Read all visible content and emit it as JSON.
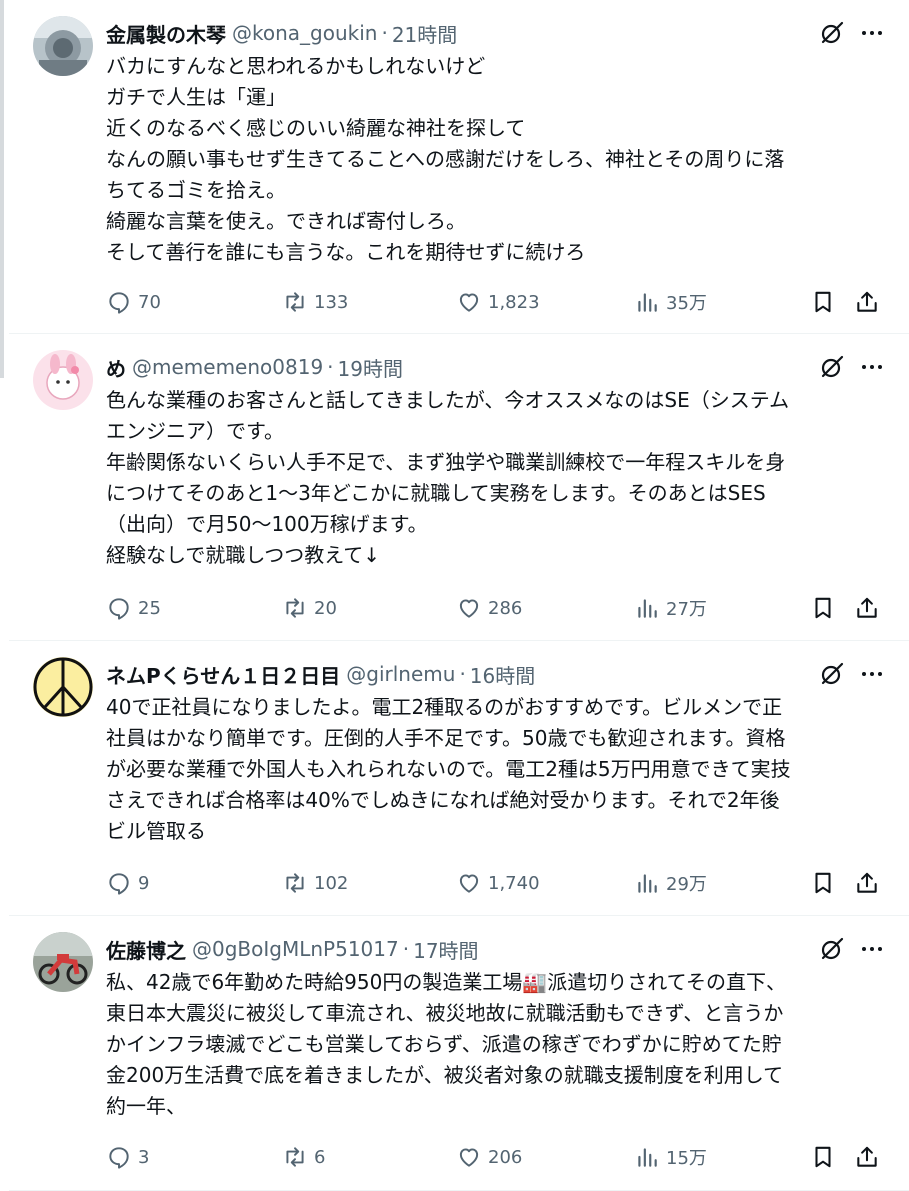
{
  "tweets": [
    {
      "name": "金属製の木琴",
      "handle": "@kona_goukin",
      "sep": "·",
      "time": "21時間",
      "lines": [
        "バカにすんなと思われるかもしれないけど",
        "ガチで人生は「運」",
        "近くのなるべく感じのいい綺麗な神社を探して",
        "なんの願い事もせず生きてることへの感謝だけをしろ、神社とその周りに落",
        "ちてるゴミを拾え。",
        "綺麗な言葉を使え。できれば寄付しろ。",
        "そして善行を誰にも言うな。これを期待せずに続けろ"
      ],
      "replies": "70",
      "retweets": "133",
      "likes": "1,823",
      "views": "35万"
    },
    {
      "name": "め",
      "handle": "@mememeno0819",
      "sep": "·",
      "time": "19時間",
      "lines": [
        "色んな業種のお客さんと話してきましたが、今オススメなのはSE（システム",
        "エンジニア）です。",
        "年齢関係ないくらい人手不足で、まず独学や職業訓練校で一年程スキルを身",
        "につけてそのあと1〜3年どこかに就職して実務をします。そのあとはSES",
        "（出向）で月50〜100万稼げます。",
        "経験なしで就職しつつ教えて↓"
      ],
      "replies": "25",
      "retweets": "20",
      "likes": "286",
      "views": "27万"
    },
    {
      "name": "ネムPくらせん１日２日目",
      "handle": "@girlnemu",
      "sep": "·",
      "time": "16時間",
      "lines": [
        "40で正社員になりましたよ。電工2種取るのがおすすめです。ビルメンで正",
        "社員はかなり簡単です。圧倒的人手不足です。50歳でも歓迎されます。資格",
        "が必要な業種で外国人も入れられないので。電工2種は5万円用意できて実技",
        "さえできれば合格率は40%でしぬきになれば絶対受かります。それで2年後",
        "ビル管取る"
      ],
      "replies": "9",
      "retweets": "102",
      "likes": "1,740",
      "views": "29万"
    },
    {
      "name": "佐藤博之",
      "handle": "@0gBoIgMLnP51017",
      "sep": "·",
      "time": "17時間",
      "lines": [
        "私、42歳で6年勤めた時給950円の製造業工場🏭派遣切りされてその直下、",
        "東日本大震災に被災して車流され、被災地故に就職活動もできず、と言うか",
        "かインフラ壊滅でどこも営業しておらず、派遣の稼ぎでわずかに貯めてた貯",
        "金200万生活費で底を着きましたが、被災者対象の就職支援制度を利用して",
        "約一年、"
      ],
      "replies": "3",
      "retweets": "6",
      "likes": "206",
      "views": "15万"
    }
  ]
}
